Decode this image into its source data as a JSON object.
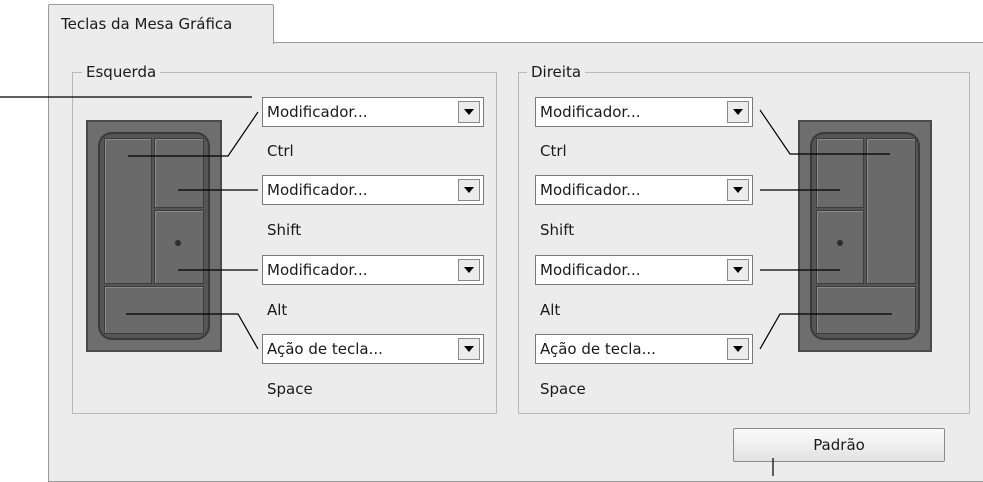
{
  "tab": {
    "label": "Teclas da Mesa Gráfica"
  },
  "left_group": {
    "title": "Esquerda",
    "rows": [
      {
        "dropdown": "Modificador...",
        "key": "Ctrl"
      },
      {
        "dropdown": "Modificador...",
        "key": "Shift"
      },
      {
        "dropdown": "Modificador...",
        "key": "Alt"
      },
      {
        "dropdown": "Ação de tecla...",
        "key": "Space"
      }
    ]
  },
  "right_group": {
    "title": "Direita",
    "rows": [
      {
        "dropdown": "Modificador...",
        "key": "Ctrl"
      },
      {
        "dropdown": "Modificador...",
        "key": "Shift"
      },
      {
        "dropdown": "Modificador...",
        "key": "Alt"
      },
      {
        "dropdown": "Ação de tecla...",
        "key": "Space"
      }
    ]
  },
  "buttons": {
    "default_label": "Padrão"
  }
}
